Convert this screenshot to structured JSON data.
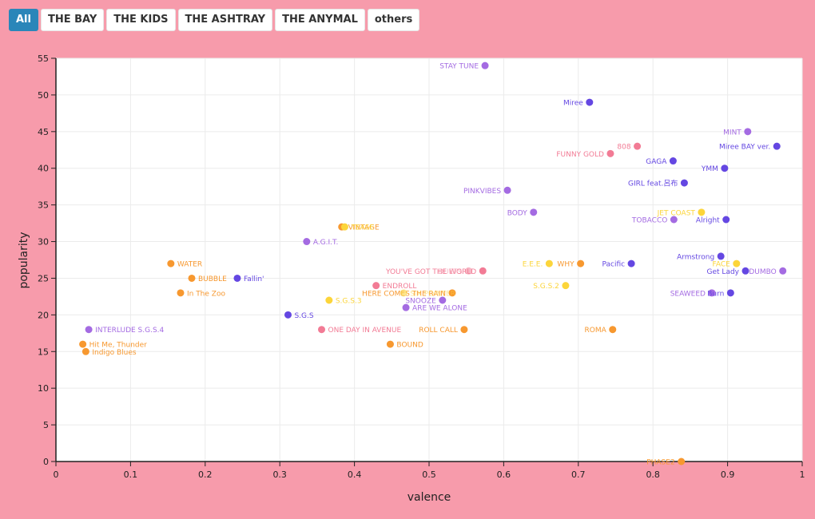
{
  "filters": {
    "buttons": [
      {
        "label": "All",
        "active": true
      },
      {
        "label": "THE BAY",
        "active": false
      },
      {
        "label": "THE KIDS",
        "active": false
      },
      {
        "label": "THE ASHTRAY",
        "active": false
      },
      {
        "label": "THE ANYMAL",
        "active": false
      },
      {
        "label": "others",
        "active": false
      }
    ]
  },
  "colors": {
    "THE BAY": "#f7982f",
    "THE KIDS": "#f27b95",
    "THE ASHTRAY": "#fcd53a",
    "THE ANYMAL": "#6447e2",
    "others": "#a46be2"
  },
  "chart_data": {
    "type": "scatter",
    "title": "",
    "xlabel": "valence",
    "ylabel": "popularity",
    "xlim": [
      0,
      1
    ],
    "ylim": [
      0,
      55
    ],
    "xticks": [
      "0",
      "0.1",
      "0.2",
      "0.3",
      "0.4",
      "0.5",
      "0.6",
      "0.7",
      "0.8",
      "0.9",
      "1"
    ],
    "yticks": [
      "0",
      "5",
      "10",
      "15",
      "20",
      "25",
      "30",
      "35",
      "40",
      "45",
      "50",
      "55"
    ],
    "grid": true,
    "series": [
      {
        "name": "STAY TUNE",
        "group": "others",
        "x": 0.575,
        "y": 54,
        "labelSide": "left"
      },
      {
        "name": "Miree",
        "group": "THE ANYMAL",
        "x": 0.715,
        "y": 49,
        "labelSide": "left"
      },
      {
        "name": "MINT",
        "group": "others",
        "x": 0.927,
        "y": 45,
        "labelSide": "left"
      },
      {
        "name": "808",
        "group": "THE KIDS",
        "x": 0.779,
        "y": 43,
        "labelSide": "left"
      },
      {
        "name": "Miree BAY ver.",
        "group": "THE ANYMAL",
        "x": 0.966,
        "y": 43,
        "labelSide": "left"
      },
      {
        "name": "FUNNY GOLD",
        "group": "THE KIDS",
        "x": 0.743,
        "y": 42,
        "labelSide": "left"
      },
      {
        "name": "GAGA",
        "group": "THE ANYMAL",
        "x": 0.827,
        "y": 41,
        "labelSide": "left"
      },
      {
        "name": "YMM",
        "group": "THE ANYMAL",
        "x": 0.896,
        "y": 40,
        "labelSide": "left"
      },
      {
        "name": "GIRL feat.呂布",
        "group": "THE ANYMAL",
        "x": 0.842,
        "y": 38,
        "labelSide": "left"
      },
      {
        "name": "PINKVIBES",
        "group": "others",
        "x": 0.605,
        "y": 37,
        "labelSide": "left"
      },
      {
        "name": "BODY",
        "group": "others",
        "x": 0.64,
        "y": 34,
        "labelSide": "left"
      },
      {
        "name": "JET COAST",
        "group": "THE ASHTRAY",
        "x": 0.865,
        "y": 34,
        "labelSide": "left"
      },
      {
        "name": "TOBACCO",
        "group": "others",
        "x": 0.828,
        "y": 33,
        "labelSide": "left"
      },
      {
        "name": "Alright",
        "group": "THE ANYMAL",
        "x": 0.898,
        "y": 33,
        "labelSide": "left"
      },
      {
        "name": "VINTAGE",
        "group": "THE BAY",
        "x": 0.383,
        "y": 32,
        "labelSide": "right"
      },
      {
        "name": "TEASE",
        "group": "THE ASHTRAY",
        "x": 0.387,
        "y": 32,
        "labelSide": "right"
      },
      {
        "name": "A.G.I.T.",
        "group": "others",
        "x": 0.336,
        "y": 30,
        "labelSide": "right"
      },
      {
        "name": "Armstrong",
        "group": "THE ANYMAL",
        "x": 0.891,
        "y": 28,
        "labelSide": "left"
      },
      {
        "name": "WATER",
        "group": "THE BAY",
        "x": 0.154,
        "y": 27,
        "labelSide": "right"
      },
      {
        "name": "E.E.E.",
        "group": "THE ASHTRAY",
        "x": 0.661,
        "y": 27,
        "labelSide": "left"
      },
      {
        "name": "WHY",
        "group": "THE BAY",
        "x": 0.703,
        "y": 27,
        "labelSide": "left"
      },
      {
        "name": "Pacific",
        "group": "THE ANYMAL",
        "x": 0.771,
        "y": 27,
        "labelSide": "left"
      },
      {
        "name": "FACE",
        "group": "THE ASHTRAY",
        "x": 0.912,
        "y": 27,
        "labelSide": "left"
      },
      {
        "name": "YOU'VE GOT THE WORLD",
        "group": "THE KIDS",
        "x": 0.572,
        "y": 26,
        "labelSide": "left"
      },
      {
        "name": "DUETS",
        "group": "THE KIDS",
        "x": 0.553,
        "y": 26,
        "labelSide": "left",
        "faint": true
      },
      {
        "name": "Get Lady",
        "group": "THE ANYMAL",
        "x": 0.924,
        "y": 26,
        "labelSide": "left"
      },
      {
        "name": "DUMBO",
        "group": "others",
        "x": 0.974,
        "y": 26,
        "labelSide": "left"
      },
      {
        "name": "BUBBLE",
        "group": "THE BAY",
        "x": 0.182,
        "y": 25,
        "labelSide": "right"
      },
      {
        "name": "Fallin'",
        "group": "THE ANYMAL",
        "x": 0.243,
        "y": 25,
        "labelSide": "right"
      },
      {
        "name": "ENDROLL",
        "group": "THE KIDS",
        "x": 0.429,
        "y": 24,
        "labelSide": "right"
      },
      {
        "name": "S.G.S.2",
        "group": "THE ASHTRAY",
        "x": 0.683,
        "y": 24,
        "labelSide": "left"
      },
      {
        "name": "In The Zoo",
        "group": "THE BAY",
        "x": 0.167,
        "y": 23,
        "labelSide": "right"
      },
      {
        "name": "HERE COMES THE RAIN",
        "group": "THE BAY",
        "x": 0.531,
        "y": 23,
        "labelSide": "left"
      },
      {
        "name": "SIX POINTER",
        "group": "THE ASHTRAY",
        "x": 0.466,
        "y": 23,
        "labelSide": "right",
        "faint": true
      },
      {
        "name": "SEAWEED",
        "group": "others",
        "x": 0.879,
        "y": 23,
        "labelSide": "left"
      },
      {
        "name": "Burn",
        "group": "THE ANYMAL",
        "x": 0.904,
        "y": 23,
        "labelSide": "left"
      },
      {
        "name": "S.G.S.3",
        "group": "THE ASHTRAY",
        "x": 0.366,
        "y": 22,
        "labelSide": "right"
      },
      {
        "name": "SNOOZE",
        "group": "others",
        "x": 0.518,
        "y": 22,
        "labelSide": "left"
      },
      {
        "name": "ARE WE ALONE",
        "group": "others",
        "x": 0.469,
        "y": 21,
        "labelSide": "right"
      },
      {
        "name": "S.G.S",
        "group": "THE ANYMAL",
        "x": 0.311,
        "y": 20,
        "labelSide": "right"
      },
      {
        "name": "INTERLUDE S.G.S.4",
        "group": "others",
        "x": 0.044,
        "y": 18,
        "labelSide": "right"
      },
      {
        "name": "ONE DAY IN AVENUE",
        "group": "THE KIDS",
        "x": 0.356,
        "y": 18,
        "labelSide": "right"
      },
      {
        "name": "ROLL CALL",
        "group": "THE BAY",
        "x": 0.547,
        "y": 18,
        "labelSide": "left"
      },
      {
        "name": "ROMA",
        "group": "THE BAY",
        "x": 0.746,
        "y": 18,
        "labelSide": "left"
      },
      {
        "name": "Hit Me, Thunder",
        "group": "THE BAY",
        "x": 0.036,
        "y": 16,
        "labelSide": "right"
      },
      {
        "name": "BOUND",
        "group": "THE BAY",
        "x": 0.448,
        "y": 16,
        "labelSide": "right"
      },
      {
        "name": "Indigo Blues",
        "group": "THE BAY",
        "x": 0.04,
        "y": 15,
        "labelSide": "right"
      },
      {
        "name": "PHASE2",
        "group": "THE BAY",
        "x": 0.838,
        "y": 0,
        "labelSide": "left"
      }
    ]
  }
}
